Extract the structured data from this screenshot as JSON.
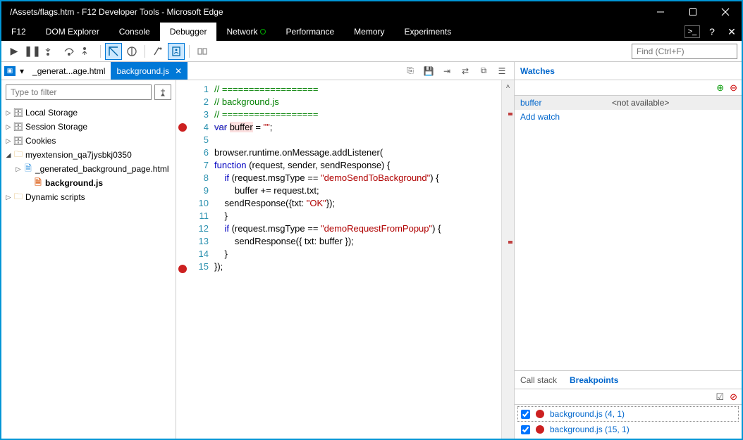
{
  "window": {
    "title": "/Assets/flags.htm - F12 Developer Tools - Microsoft Edge"
  },
  "mainTabs": {
    "f12": "F12",
    "dom": "DOM Explorer",
    "console": "Console",
    "debugger": "Debugger",
    "network": "Network",
    "perf": "Performance",
    "memory": "Memory",
    "exp": "Experiments"
  },
  "toolbar": {
    "findPlaceholder": "Find (Ctrl+F)"
  },
  "fileTabs": {
    "inactive": "_generat...age.html",
    "active": "background.js"
  },
  "filter": {
    "placeholder": "Type to filter"
  },
  "tree": {
    "localStorage": "Local Storage",
    "sessionStorage": "Session Storage",
    "cookies": "Cookies",
    "ext": "myextension_qa7jysbkj0350",
    "extPage": "_generated_background_page.html",
    "extScript": "background.js",
    "dynamic": "Dynamic scripts"
  },
  "code": {
    "lines": [
      {
        "n": 1,
        "html": "<span class='c-com'>// ==================</span>"
      },
      {
        "n": 2,
        "html": "<span class='c-com'>// background.js</span>"
      },
      {
        "n": 3,
        "html": "<span class='c-com'>// ==================</span>"
      },
      {
        "n": 4,
        "bp": true,
        "html": "<span class='c-kw c-strk'>var</span> <span class='c-var'>buffer</span> = <span class='c-str'>\"\"</span>;"
      },
      {
        "n": 5,
        "html": ""
      },
      {
        "n": 6,
        "html": "browser.runtime.onMessage.addListener("
      },
      {
        "n": 7,
        "html": "<span class='c-kw'>function</span> (request, sender, sendResponse) {"
      },
      {
        "n": 8,
        "html": "    <span class='c-kw'>if</span> (request.msgType == <span class='c-str'>\"demoSendToBackground\"</span>) {"
      },
      {
        "n": 9,
        "html": "        buffer += request.txt;"
      },
      {
        "n": 10,
        "html": "    sendResponse({txt: <span class='c-str'>\"OK\"</span>});"
      },
      {
        "n": 11,
        "html": "    }"
      },
      {
        "n": 12,
        "html": "    <span class='c-kw'>if</span> (request.msgType == <span class='c-str'>\"demoRequestFromPopup\"</span>) {"
      },
      {
        "n": 13,
        "html": "        sendResponse({ txt: buffer });"
      },
      {
        "n": 14,
        "html": "    }"
      },
      {
        "n": 15,
        "bp": true,
        "html": "});"
      }
    ]
  },
  "watches": {
    "title": "Watches",
    "items": [
      {
        "name": "buffer",
        "value": "<not available>"
      }
    ],
    "add": "Add watch"
  },
  "callstack": {
    "callstack": "Call stack",
    "breakpoints": "Breakpoints"
  },
  "bps": {
    "items": [
      {
        "label": "background.js (4, 1)"
      },
      {
        "label": "background.js (15, 1)"
      }
    ]
  }
}
